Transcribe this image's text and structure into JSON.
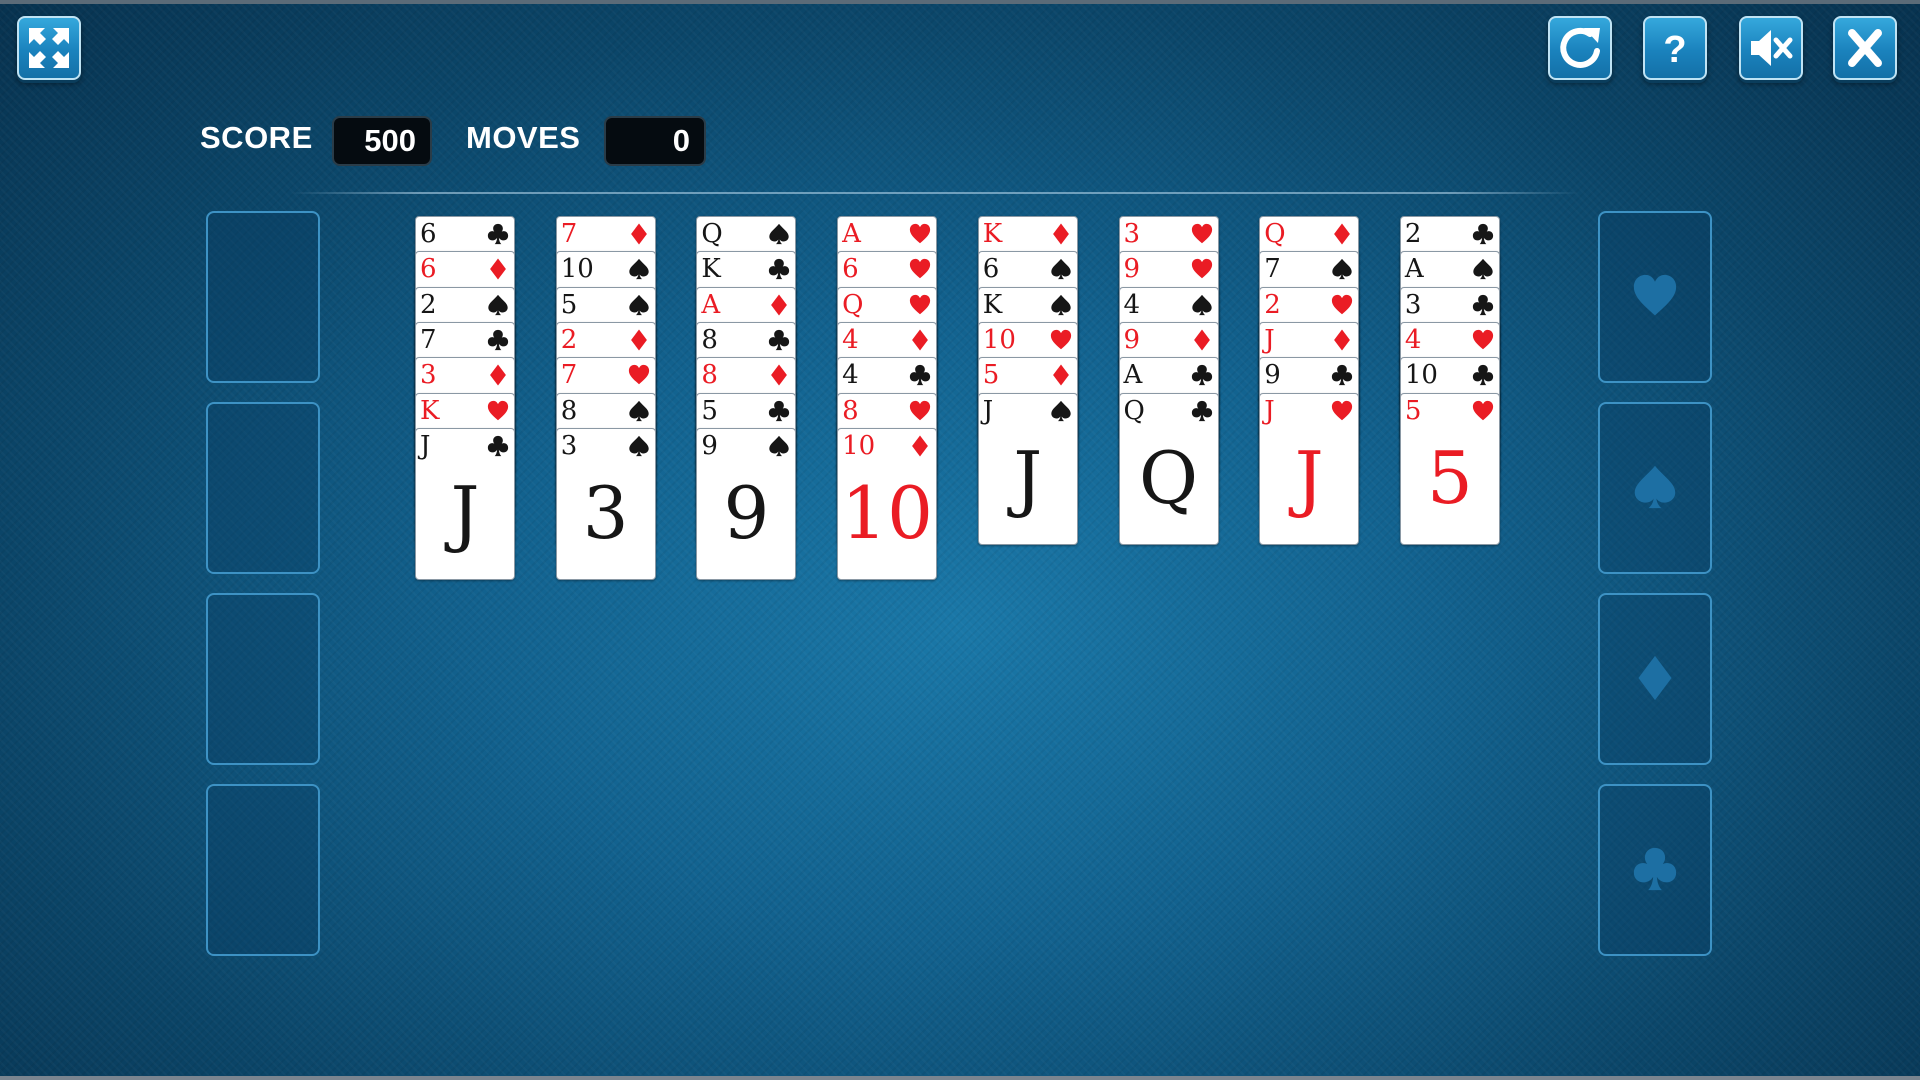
{
  "toolbar": {
    "fullscreen_icon": "fullscreen-icon",
    "restart_icon": "restart-icon",
    "help_icon": "help-icon",
    "mute_icon": "sound-muted-icon",
    "close_icon": "close-icon"
  },
  "hud": {
    "score_label": "SCORE",
    "score_value": "500",
    "moves_label": "MOVES",
    "moves_value": "0"
  },
  "free_cells": [
    {
      "card": null
    },
    {
      "card": null
    },
    {
      "card": null
    },
    {
      "card": null
    }
  ],
  "foundations": [
    {
      "suit": "hearts",
      "card": null
    },
    {
      "suit": "spades",
      "card": null
    },
    {
      "suit": "diamonds",
      "card": null
    },
    {
      "suit": "clubs",
      "card": null
    }
  ],
  "tableau": [
    [
      {
        "rank": "6",
        "suit": "clubs"
      },
      {
        "rank": "6",
        "suit": "diamonds"
      },
      {
        "rank": "2",
        "suit": "spades"
      },
      {
        "rank": "7",
        "suit": "clubs"
      },
      {
        "rank": "3",
        "suit": "diamonds"
      },
      {
        "rank": "K",
        "suit": "hearts"
      },
      {
        "rank": "J",
        "suit": "clubs"
      }
    ],
    [
      {
        "rank": "7",
        "suit": "diamonds"
      },
      {
        "rank": "10",
        "suit": "spades"
      },
      {
        "rank": "5",
        "suit": "spades"
      },
      {
        "rank": "2",
        "suit": "diamonds"
      },
      {
        "rank": "7",
        "suit": "hearts"
      },
      {
        "rank": "8",
        "suit": "spades"
      },
      {
        "rank": "3",
        "suit": "spades"
      }
    ],
    [
      {
        "rank": "Q",
        "suit": "spades"
      },
      {
        "rank": "K",
        "suit": "clubs"
      },
      {
        "rank": "A",
        "suit": "diamonds"
      },
      {
        "rank": "8",
        "suit": "clubs"
      },
      {
        "rank": "8",
        "suit": "diamonds"
      },
      {
        "rank": "5",
        "suit": "clubs"
      },
      {
        "rank": "9",
        "suit": "spades"
      }
    ],
    [
      {
        "rank": "A",
        "suit": "hearts"
      },
      {
        "rank": "6",
        "suit": "hearts"
      },
      {
        "rank": "Q",
        "suit": "hearts"
      },
      {
        "rank": "4",
        "suit": "diamonds"
      },
      {
        "rank": "4",
        "suit": "clubs"
      },
      {
        "rank": "8",
        "suit": "hearts"
      },
      {
        "rank": "10",
        "suit": "diamonds"
      }
    ],
    [
      {
        "rank": "K",
        "suit": "diamonds"
      },
      {
        "rank": "6",
        "suit": "spades"
      },
      {
        "rank": "K",
        "suit": "spades"
      },
      {
        "rank": "10",
        "suit": "hearts"
      },
      {
        "rank": "5",
        "suit": "diamonds"
      },
      {
        "rank": "J",
        "suit": "spades"
      }
    ],
    [
      {
        "rank": "3",
        "suit": "hearts"
      },
      {
        "rank": "9",
        "suit": "hearts"
      },
      {
        "rank": "4",
        "suit": "spades"
      },
      {
        "rank": "9",
        "suit": "diamonds"
      },
      {
        "rank": "A",
        "suit": "clubs"
      },
      {
        "rank": "Q",
        "suit": "clubs"
      }
    ],
    [
      {
        "rank": "Q",
        "suit": "diamonds"
      },
      {
        "rank": "7",
        "suit": "spades"
      },
      {
        "rank": "2",
        "suit": "hearts"
      },
      {
        "rank": "J",
        "suit": "diamonds"
      },
      {
        "rank": "9",
        "suit": "clubs"
      },
      {
        "rank": "J",
        "suit": "hearts"
      }
    ],
    [
      {
        "rank": "2",
        "suit": "clubs"
      },
      {
        "rank": "A",
        "suit": "spades"
      },
      {
        "rank": "3",
        "suit": "clubs"
      },
      {
        "rank": "4",
        "suit": "hearts"
      },
      {
        "rank": "10",
        "suit": "clubs"
      },
      {
        "rank": "5",
        "suit": "hearts"
      }
    ]
  ],
  "colors": {
    "red_suit": "#ea1c24",
    "black_suit": "#161616",
    "foundation_marker": "#1d6fa3"
  }
}
